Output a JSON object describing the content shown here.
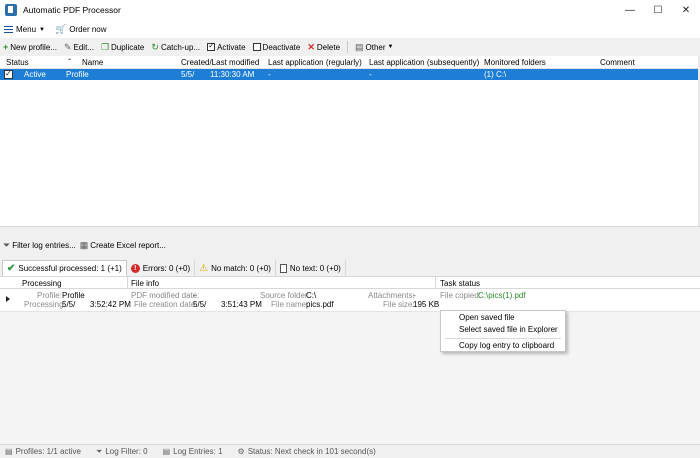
{
  "window": {
    "title": "Automatic PDF Processor",
    "minimize": "—",
    "maximize": "☐",
    "close": "✕"
  },
  "menubar": {
    "menu_label": "Menu",
    "order_label": "Order now"
  },
  "toolbar": {
    "new_profile": "New profile...",
    "edit": "Edit...",
    "duplicate": "Duplicate",
    "catch_up": "Catch-up...",
    "activate": "Activate",
    "deactivate": "Deactivate",
    "delete": "Delete",
    "other": "Other"
  },
  "profiles_table": {
    "columns": [
      "Status",
      "Name",
      "Created/Last modified",
      "Last application (regularly)",
      "Last application (subsequently)",
      "Monitored folders",
      "Comment"
    ],
    "rows": [
      {
        "status": "Active",
        "name": "Profile",
        "created": "5/5/",
        "modified_time": "11:30:30 AM",
        "last_regular": "-",
        "last_subsequent": "-",
        "monitored": "(1) C:\\",
        "comment": ""
      }
    ]
  },
  "log_toolbar": {
    "filter": "Filter log entries...",
    "excel": "Create Excel report..."
  },
  "log_tabs": [
    {
      "label": "Successful processed: 1  (+1)"
    },
    {
      "label": "Errors: 0  (+0)"
    },
    {
      "label": "No match: 0  (+0)"
    },
    {
      "label": "No text: 0  (+0)"
    }
  ],
  "log_table": {
    "columns": [
      "Processing",
      "File info",
      "Task status"
    ],
    "entry": {
      "profile_label": "Profile:",
      "profile_value": "Profile",
      "processing_label": "Processing:",
      "processing_value": "5/5/",
      "processing_time": "3:52:42 PM",
      "pdf_modified_label": "PDF modified date:",
      "pdf_modified_value": "-",
      "file_creation_label": "File creation date:",
      "file_creation_value": "5/5/",
      "file_creation_time": "3:51:43 PM",
      "source_folder_label": "Source folder:",
      "source_folder_value": "C:\\",
      "file_name_label": "File name:",
      "file_name_value": "pics.pdf",
      "attachments_label": "Attachments:",
      "attachments_value": "-",
      "file_size_label": "File size:",
      "file_size_value": "195 KB",
      "file_copied_label": "File copied:",
      "file_copied_value": "C:\\pics(1).pdf"
    }
  },
  "context_menu": {
    "items": [
      "Open saved file",
      "Select saved file in Explorer",
      "Copy log entry to clipboard"
    ]
  },
  "statusbar": {
    "profiles": "Profiles: 1/1 active",
    "log_filter": "Log Filter: 0",
    "log_entries": "Log Entries: 1",
    "status": "Status: Next check in 101 second(s)"
  }
}
